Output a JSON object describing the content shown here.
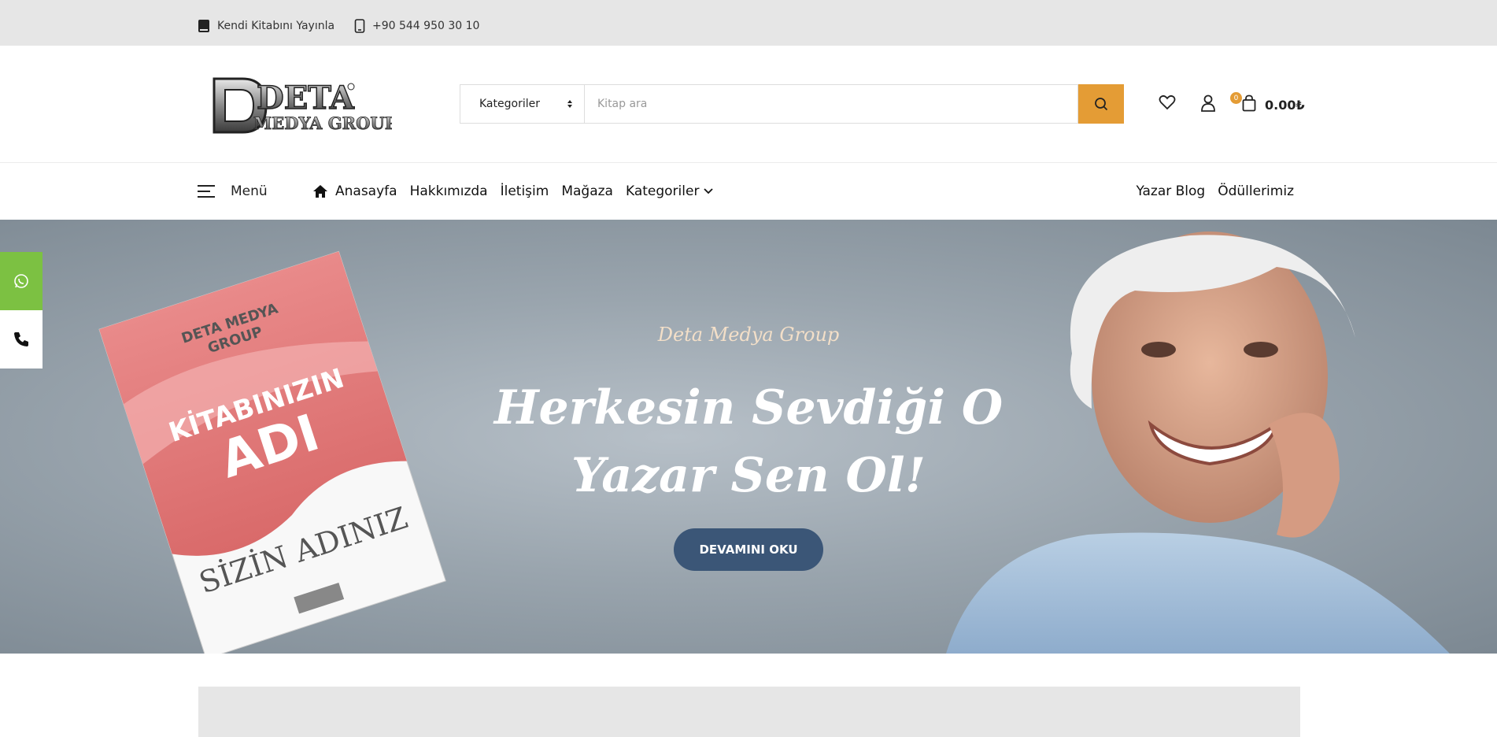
{
  "topbar": {
    "publish_label": "Kendi Kitabını Yayınla",
    "phone": "+90 544 950 30 10"
  },
  "header": {
    "logo_text_main": "DETA",
    "logo_text_sub": "MEDYA GROUP",
    "search": {
      "category_label": "Kategoriler",
      "placeholder": "Kitap ara"
    },
    "cart": {
      "count": "0",
      "total": "0.00₺"
    }
  },
  "nav": {
    "menu_label": "Menü",
    "links": [
      "Anasayfa",
      "Hakkımızda",
      "İletişim",
      "Mağaza",
      "Kategoriler"
    ],
    "right_links": [
      "Yazar Blog",
      "Ödüllerimiz"
    ]
  },
  "hero": {
    "subtitle": "Deta Medya Group",
    "title": "Herkesin Sevdiği O Yazar Sen Ol!",
    "cta": "DEVAMINI OKU",
    "book": {
      "brand": "DETA MEDYA\nGROUP",
      "title_line1": "KİTABINIZIN",
      "title_line2": "ADI",
      "author": "SİZİN ADINIZ"
    }
  },
  "colors": {
    "accent": "#e49c35",
    "cta": "#3b5677",
    "whatsapp": "#7cc142",
    "topbar": "#e6e6e6"
  }
}
